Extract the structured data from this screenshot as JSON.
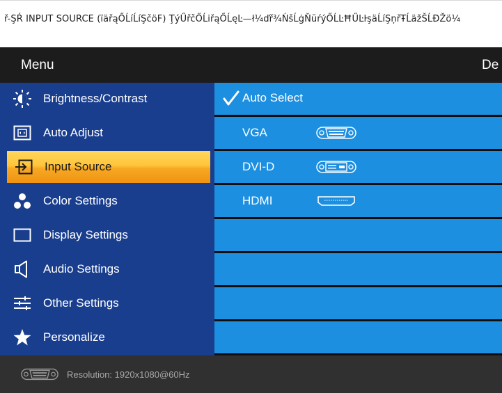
{
  "caption": "ř-ŞŔ INPUT SOURCE (ïäřąŐĹíĹíŞčöF) ŢýŰřčŐĹiřąŐĹęĿ—ł¼ďř¾ŃšĹġŇŭŕýŐĹĿĦŰĿŀşäĹíŞņřŦĹäžŠĹĐŽö¼",
  "osd": {
    "header_title": "Menu",
    "header_right": "De",
    "menu_items": [
      {
        "label": "Brightness/Contrast",
        "icon": "brightness-icon"
      },
      {
        "label": "Auto Adjust",
        "icon": "auto-adjust-icon"
      },
      {
        "label": "Input Source",
        "icon": "input-source-icon",
        "selected": true
      },
      {
        "label": "Color Settings",
        "icon": "color-settings-icon"
      },
      {
        "label": "Display Settings",
        "icon": "display-settings-icon"
      },
      {
        "label": "Audio Settings",
        "icon": "speaker-icon"
      },
      {
        "label": "Other Settings",
        "icon": "other-settings-icon"
      },
      {
        "label": "Personalize",
        "icon": "star-icon"
      }
    ],
    "sub_items": [
      {
        "label": "Auto Select",
        "checked": true
      },
      {
        "label": "VGA",
        "connector": "vga-connector-icon"
      },
      {
        "label": "DVI-D",
        "connector": "dvi-connector-icon"
      },
      {
        "label": "HDMI",
        "connector": "hdmi-connector-icon"
      },
      {
        "label": ""
      },
      {
        "label": ""
      },
      {
        "label": ""
      },
      {
        "label": ""
      }
    ],
    "footer_resolution": "Resolution: 1920x1080@60Hz",
    "footer_connector": "vga-connector-icon",
    "colors": {
      "menu_bg": "#1a3e8e",
      "submenu_bg": "#1d8fe0",
      "selected_bg": "#ffc53a",
      "header_bg": "#1c1c1c",
      "footer_bg": "#303030"
    }
  }
}
